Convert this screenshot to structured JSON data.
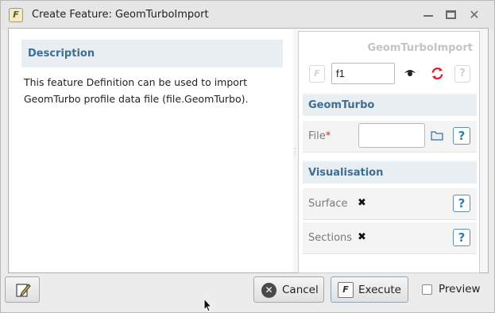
{
  "window": {
    "title": "Create Feature: GeomTurboImport",
    "app_icon_glyph": "F",
    "controls": [
      "minimize",
      "maximize",
      "close"
    ]
  },
  "description": {
    "heading": "Description",
    "text": "This feature Definition can be used to import GeomTurbo profile data file (file.GeomTurbo)."
  },
  "feature": {
    "type_name": "GeomTurboImport",
    "f_glyph": "F",
    "name_value": "f1",
    "help_glyph": "?"
  },
  "sections": {
    "geomturbo": {
      "title": "GeomTurbo",
      "file_label": "File",
      "required_marker": "*",
      "file_value": "",
      "help_glyph": "?"
    },
    "visualisation": {
      "title": "Visualisation",
      "surface_label": "Surface",
      "surface_mark": "✖",
      "sections_label": "Sections",
      "sections_mark": "✖",
      "help_glyph": "?"
    }
  },
  "buttons": {
    "cancel": "Cancel",
    "execute": "Execute",
    "execute_icon_glyph": "F",
    "preview": "Preview",
    "preview_checked": false
  },
  "colors": {
    "accent": "#3f6e93",
    "required": "#b4333c",
    "refresh": "#d9262e",
    "help": "#2f7fb6"
  }
}
